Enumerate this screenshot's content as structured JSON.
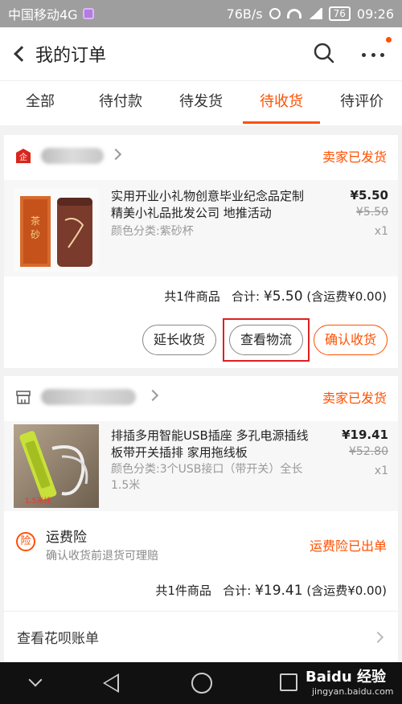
{
  "status_bar": {
    "carrier": "中国移动4G",
    "speed": "76B/s",
    "battery": "76",
    "time": "09:26"
  },
  "header": {
    "title": "我的订单"
  },
  "tabs": [
    {
      "label": "全部"
    },
    {
      "label": "待付款"
    },
    {
      "label": "待发货"
    },
    {
      "label": "待收货"
    },
    {
      "label": "待评价"
    }
  ],
  "orders": [
    {
      "status": "卖家已发货",
      "item": {
        "title": "实用开业小礼物创意毕业纪念品定制精美小礼品批发公司 地推活动",
        "variant": "颜色分类:紫砂杯",
        "price": "¥5.50",
        "original_price": "¥5.50",
        "quantity": "x1"
      },
      "summary": {
        "count": "共1件商品",
        "total_label": "合计:",
        "total": "¥5.50",
        "shipping": "(含运费¥0.00)"
      },
      "buttons": {
        "extend": "延长收货",
        "logistics": "查看物流",
        "confirm": "确认收货"
      }
    },
    {
      "status": "卖家已发货",
      "item": {
        "title": "排插多用智能USB插座 多孔电源插线板带开关插排 家用拖线板",
        "variant": "颜色分类:3个USB接口（带开关）全长1.5米",
        "price": "¥19.41",
        "original_price": "¥52.80",
        "quantity": "x1",
        "thumb_caption": "1.5米线"
      },
      "insurance": {
        "icon_text": "险",
        "title": "运费险",
        "subtitle": "确认收货前退货可理赔",
        "status": "运费险已出单"
      },
      "summary": {
        "count": "共1件商品",
        "total_label": "合计:",
        "total": "¥19.41",
        "shipping": "(含运费¥0.00)"
      },
      "huabei_label": "查看花呗账单"
    }
  ],
  "watermark": {
    "brand": "Baidu 经验",
    "url": "jingyan.baidu.com"
  },
  "colors": {
    "accent": "#ff5000",
    "highlight": "#e02020"
  }
}
